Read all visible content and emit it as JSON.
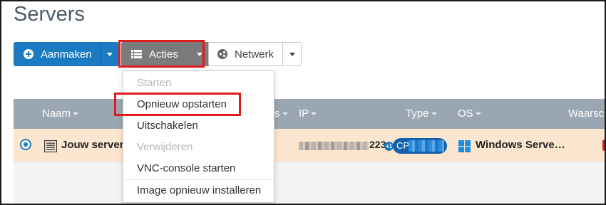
{
  "page": {
    "title": "Servers"
  },
  "toolbar": {
    "create_label": "Aanmaken",
    "actions_label": "Acties",
    "network_label": "Netwerk"
  },
  "colors": {
    "primary": "#1a7bc3",
    "actions_button": "#7b7b7b",
    "table_header": "#9aa6b2",
    "selected_row": "#fde6cf",
    "highlight": "#e01b1b"
  },
  "table": {
    "columns": [
      "Naam",
      "s",
      "IP",
      "Type",
      "OS",
      "Waarsch"
    ],
    "row": {
      "name": "Jouw server",
      "ip_suffix": "223",
      "ip_extra_count": "+1",
      "type_prefix": "CP",
      "os": "Windows Serve…"
    }
  },
  "actions_menu": {
    "items": [
      {
        "label": "Starten",
        "disabled": true
      },
      {
        "label": "Opnieuw opstarten",
        "disabled": false
      },
      {
        "label": "Uitschakelen",
        "disabled": false
      },
      {
        "label": "Verwijderen",
        "disabled": true
      },
      {
        "label": "VNC-console starten",
        "disabled": false
      },
      {
        "label": "Image opnieuw installeren",
        "disabled": false
      }
    ]
  },
  "icons": {
    "create": "plus-circle-icon",
    "actions": "list-icon",
    "network": "network-icon",
    "server": "server-icon",
    "os": "windows-icon"
  }
}
